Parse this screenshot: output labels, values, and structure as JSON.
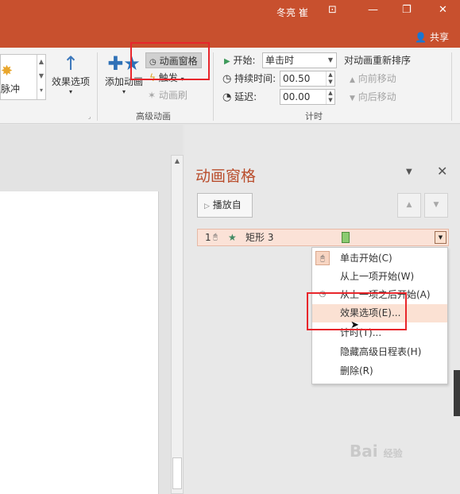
{
  "titlebar": {
    "user": "冬亮 崔",
    "controls": {
      "ribbon_display": "⊡",
      "minimize": "—",
      "restore": "❐",
      "close": "✕"
    }
  },
  "tabrow": {
    "share": "共享"
  },
  "ribbon": {
    "gallery": {
      "visible_label": "脉冲"
    },
    "effect_options": "效果选项",
    "add_animation": "添加动画",
    "animation_pane": "动画窗格",
    "trigger": "触发",
    "animation_painter": "动画刷",
    "group_advanced": "高级动画",
    "start_label": "开始:",
    "start_value": "单击时",
    "duration_label": "持续时间:",
    "duration_value": "00.50",
    "delay_label": "延迟:",
    "delay_value": "00.00",
    "group_timing": "计时",
    "reorder_title": "对动画重新排序",
    "move_earlier": "向前移动",
    "move_later": "向后移动"
  },
  "pane": {
    "title": "动画窗格",
    "play_from": "播放自",
    "item": {
      "number": "1",
      "name": "矩形 3"
    }
  },
  "context_menu": {
    "items": [
      "单击开始(C)",
      "从上一项开始(W)",
      "从上一项之后开始(A)",
      "效果选项(E)...",
      "计时(T)...",
      "隐藏高级日程表(H)",
      "删除(R)"
    ]
  },
  "watermark": {
    "text": "Bai",
    "suffix": "经验"
  },
  "colors": {
    "accent": "#c8502e",
    "pane_title": "#b94d2c",
    "highlight_box": "#e8262b",
    "menu_hover": "#fbe1d3"
  }
}
